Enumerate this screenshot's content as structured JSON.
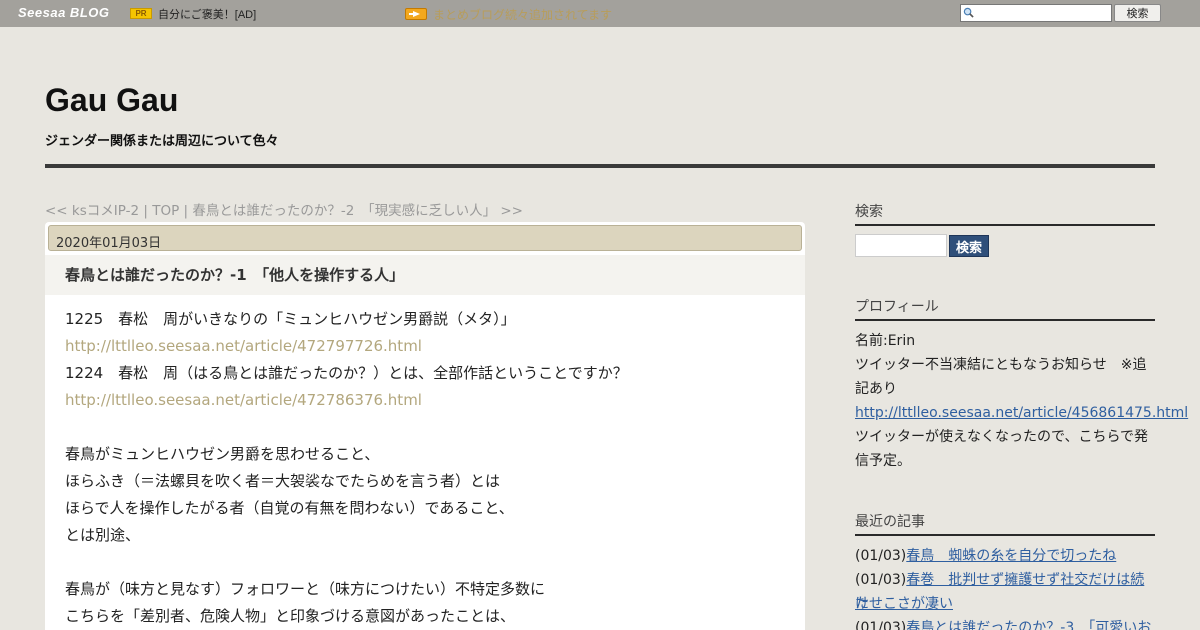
{
  "topbar": {
    "logo": "Seesaa BLOG",
    "pr_badge": "PR",
    "ad_text": "自分にご褒美！[AD]",
    "notice_link": "まとめブログ続々追加されてます",
    "search_button": "検索"
  },
  "header": {
    "title": "Gau Gau",
    "description": "ジェンダー関係または周辺について色々"
  },
  "post_nav": {
    "prev": "<< ksコメIP-2",
    "sep1": " | ",
    "top": "TOP",
    "sep2": " | ",
    "next": "春鳥とは誰だったのか？-2　「現実感に乏しい人」 >>"
  },
  "post": {
    "date": "2020年01月03日",
    "title": "春鳥とは誰だったのか？-1　「他人を操作する人」",
    "lines": [
      {
        "text": "1225　春松　周がいきなりの「ミュンヒハウゼン男爵説（メタ）」",
        "link": false
      },
      {
        "text": "http://lttlleo.seesaa.net/article/472797726.html",
        "link": true
      },
      {
        "text": "1224　春松　周（はる鳥とは誰だったのか？）とは、全部作話ということですか？",
        "link": false
      },
      {
        "text": "http://lttlleo.seesaa.net/article/472786376.html",
        "link": true
      },
      {
        "text": "",
        "link": false
      },
      {
        "text": "春鳥がミュンヒハウゼン男爵を思わせること、",
        "link": false
      },
      {
        "text": "ほらふき（＝法螺貝を吹く者＝大袈裟なでたらめを言う者）とは",
        "link": false
      },
      {
        "text": "ほらで人を操作したがる者（自覚の有無を問わない）であること、",
        "link": false
      },
      {
        "text": "とは別途、",
        "link": false
      },
      {
        "text": "",
        "link": false
      },
      {
        "text": "春鳥が（味方と見なす）フォロワーと（味方につけたい）不特定多数に",
        "link": false
      },
      {
        "text": "こちらを「差別者、危険人物」と印象づける意図があったことは、",
        "link": false
      }
    ]
  },
  "sidebar": {
    "search_heading": "検索",
    "search_button": "検索",
    "profile_heading": "プロフィール",
    "profile_name": "名前:Erin",
    "profile_notice_1": "ツイッター不当凍結にともなうお知らせ　※追",
    "profile_notice_2": "記あり",
    "profile_link": "http://lttlleo.seesaa.net/article/456861475.html",
    "profile_note_1": "ツイッターが使えなくなったので、こちらで発",
    "profile_note_2": "信予定。",
    "recent_heading": "最近の記事",
    "recent": [
      {
        "date": "(01/03)",
        "title": "春鳥　蜘蛛の糸を自分で切ったね"
      },
      {
        "date": "(01/03)",
        "title": "春巻　批判せず擁護せず社交だけは続け"
      },
      {
        "date": "",
        "title": "たせこさが凄い"
      },
      {
        "date": "(01/03)",
        "title": "春鳥とは誰だったのか？-3　「可愛いお"
      }
    ]
  }
}
